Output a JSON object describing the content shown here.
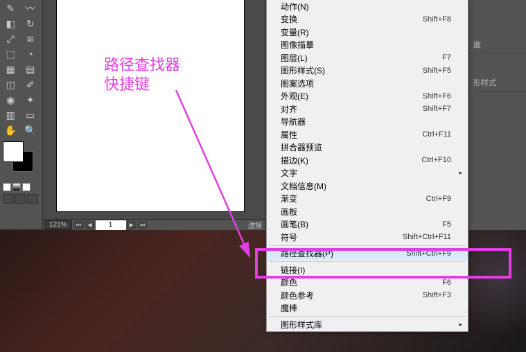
{
  "annotation": {
    "line1": "路径查找器",
    "line2": "快捷键"
  },
  "zoom": {
    "value": "121%",
    "page": "1"
  },
  "right_panels": {
    "p1": "度",
    "p2": "形样式"
  },
  "transform_label": "送接",
  "menu": [
    {
      "label": "动作(N)",
      "shortcut": "",
      "sep": false
    },
    {
      "label": "变换",
      "shortcut": "Shift+F8",
      "sep": false
    },
    {
      "label": "变量(R)",
      "shortcut": "",
      "sep": false
    },
    {
      "label": "图像描摹",
      "shortcut": "",
      "sep": false
    },
    {
      "label": "图层(L)",
      "shortcut": "F7",
      "sep": false
    },
    {
      "label": "图形样式(S)",
      "shortcut": "Shift+F5",
      "sep": false
    },
    {
      "label": "图案选项",
      "shortcut": "",
      "sep": false
    },
    {
      "label": "外观(E)",
      "shortcut": "Shift+F6",
      "sep": false
    },
    {
      "label": "对齐",
      "shortcut": "Shift+F7",
      "sep": false
    },
    {
      "label": "导航器",
      "shortcut": "",
      "sep": false
    },
    {
      "label": "属性",
      "shortcut": "Ctrl+F11",
      "sep": false
    },
    {
      "label": "拼合器预览",
      "shortcut": "",
      "sep": false
    },
    {
      "label": "描边(K)",
      "shortcut": "Ctrl+F10",
      "sep": false
    },
    {
      "label": "文字",
      "shortcut": "",
      "sep": false,
      "submenu": true
    },
    {
      "label": "文档信息(M)",
      "shortcut": "",
      "sep": false
    },
    {
      "label": "渐变",
      "shortcut": "Ctrl+F9",
      "sep": false
    },
    {
      "label": "画板",
      "shortcut": "",
      "sep": false
    },
    {
      "label": "画笔(B)",
      "shortcut": "F5",
      "sep": false
    },
    {
      "label": "符号",
      "shortcut": "Shift+Ctrl+F11",
      "sep": false
    },
    {
      "sep": true
    },
    {
      "label": "路径查找器(P)",
      "shortcut": "Shift+Ctrl+F9",
      "sep": false,
      "hl": true
    },
    {
      "sep": true
    },
    {
      "label": "链接(I)",
      "shortcut": "",
      "sep": false
    },
    {
      "label": "颜色",
      "shortcut": "F6",
      "sep": false
    },
    {
      "label": "颜色参考",
      "shortcut": "Shift+F3",
      "sep": false
    },
    {
      "label": "魔棒",
      "shortcut": "",
      "sep": false
    },
    {
      "sep": true
    },
    {
      "label": "图形样式库",
      "shortcut": "",
      "sep": false,
      "submenu": true
    }
  ],
  "tools": [
    [
      "eyedropper-icon",
      "blend-icon"
    ],
    [
      "symbol-icon",
      "graph-icon"
    ],
    [
      "artboard-icon",
      "slice-icon"
    ],
    [
      "hand-icon",
      "zoom-icon"
    ]
  ]
}
